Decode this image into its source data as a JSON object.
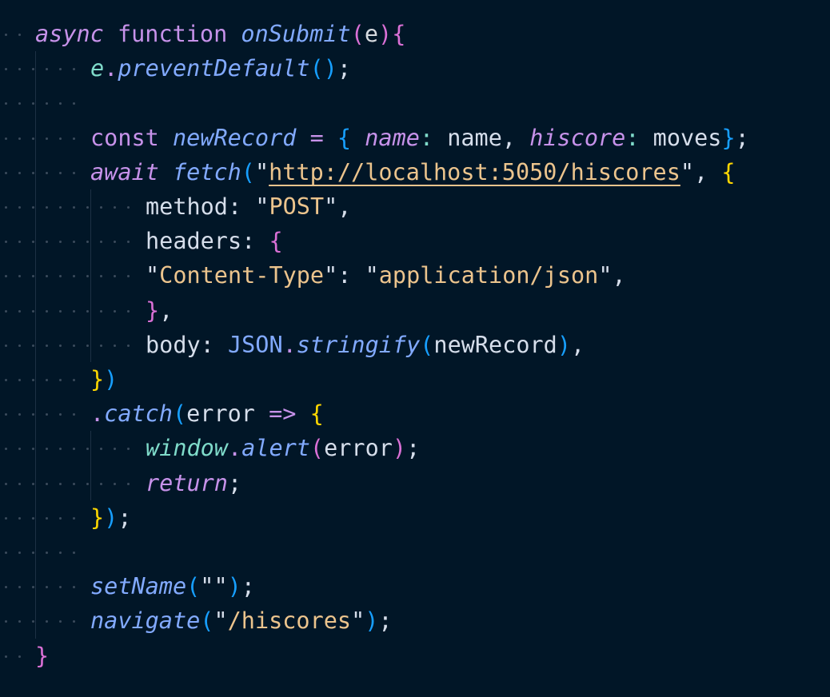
{
  "editor": {
    "theme_colors": {
      "background": "#011627",
      "keyword": "#c792ea",
      "function": "#82aaff",
      "string": "#ecc48d",
      "plain": "#d6deeb",
      "bracket_gold": "#ffd700",
      "bracket_orchid": "#da70d6",
      "bracket_blue": "#179fff"
    },
    "lines": [
      {
        "indent": 0,
        "tokens": [
          {
            "t": "async",
            "c": "kwi"
          },
          {
            "t": " ",
            "c": "pl"
          },
          {
            "t": "function",
            "c": "kw"
          },
          {
            "t": " ",
            "c": "pl"
          },
          {
            "t": "onSubmit",
            "c": "fn"
          },
          {
            "t": "(",
            "c": "b2"
          },
          {
            "t": "e",
            "c": "prm"
          },
          {
            "t": ")",
            "c": "b2"
          },
          {
            "t": "{",
            "c": "b2"
          }
        ]
      },
      {
        "indent": 1,
        "tokens": [
          {
            "t": "e",
            "c": "win"
          },
          {
            "t": ".",
            "c": "dot"
          },
          {
            "t": "preventDefault",
            "c": "fn"
          },
          {
            "t": "()",
            "c": "b3"
          },
          {
            "t": ";",
            "c": "pl"
          }
        ]
      },
      {
        "indent": 1,
        "tokens": []
      },
      {
        "indent": 1,
        "tokens": [
          {
            "t": "const",
            "c": "kw"
          },
          {
            "t": " ",
            "c": "pl"
          },
          {
            "t": "newRecord",
            "c": "var"
          },
          {
            "t": " ",
            "c": "pl"
          },
          {
            "t": "=",
            "c": "kw"
          },
          {
            "t": " ",
            "c": "pl"
          },
          {
            "t": "{",
            "c": "b3"
          },
          {
            "t": " ",
            "c": "pl"
          },
          {
            "t": "name",
            "c": "key"
          },
          {
            "t": ":",
            "c": "pnc"
          },
          {
            "t": " name",
            "c": "pl"
          },
          {
            "t": ",",
            "c": "pl"
          },
          {
            "t": " ",
            "c": "pl"
          },
          {
            "t": "hiscore",
            "c": "key"
          },
          {
            "t": ":",
            "c": "pnc"
          },
          {
            "t": " moves",
            "c": "pl"
          },
          {
            "t": "}",
            "c": "b3"
          },
          {
            "t": ";",
            "c": "pl"
          }
        ]
      },
      {
        "indent": 1,
        "tokens": [
          {
            "t": "await",
            "c": "kwi"
          },
          {
            "t": " ",
            "c": "pl"
          },
          {
            "t": "fetch",
            "c": "fn"
          },
          {
            "t": "(",
            "c": "b3"
          },
          {
            "t": "\"",
            "c": "pl"
          },
          {
            "t": "http://localhost:5050/hiscores",
            "c": "url"
          },
          {
            "t": "\"",
            "c": "pl"
          },
          {
            "t": ",",
            "c": "pl"
          },
          {
            "t": " ",
            "c": "pl"
          },
          {
            "t": "{",
            "c": "b1"
          }
        ]
      },
      {
        "indent": 2,
        "tokens": [
          {
            "t": "method",
            "c": "pl"
          },
          {
            "t": ":",
            "c": "pl"
          },
          {
            "t": " ",
            "c": "pl"
          },
          {
            "t": "\"",
            "c": "pl"
          },
          {
            "t": "POST",
            "c": "str"
          },
          {
            "t": "\"",
            "c": "pl"
          },
          {
            "t": ",",
            "c": "pl"
          }
        ]
      },
      {
        "indent": 2,
        "tokens": [
          {
            "t": "headers",
            "c": "pl"
          },
          {
            "t": ":",
            "c": "pl"
          },
          {
            "t": " ",
            "c": "pl"
          },
          {
            "t": "{",
            "c": "b2"
          }
        ]
      },
      {
        "indent": 2,
        "tokens": [
          {
            "t": "\"",
            "c": "pl"
          },
          {
            "t": "Content-Type",
            "c": "str"
          },
          {
            "t": "\"",
            "c": "pl"
          },
          {
            "t": ":",
            "c": "pl"
          },
          {
            "t": " ",
            "c": "pl"
          },
          {
            "t": "\"",
            "c": "pl"
          },
          {
            "t": "application/json",
            "c": "str"
          },
          {
            "t": "\"",
            "c": "pl"
          },
          {
            "t": ",",
            "c": "pl"
          }
        ]
      },
      {
        "indent": 2,
        "tokens": [
          {
            "t": "}",
            "c": "b2"
          },
          {
            "t": ",",
            "c": "pl"
          }
        ]
      },
      {
        "indent": 2,
        "tokens": [
          {
            "t": "body",
            "c": "pl"
          },
          {
            "t": ":",
            "c": "pl"
          },
          {
            "t": " ",
            "c": "pl"
          },
          {
            "t": "JSON",
            "c": "cls"
          },
          {
            "t": ".",
            "c": "dot"
          },
          {
            "t": "stringify",
            "c": "fn"
          },
          {
            "t": "(",
            "c": "b3"
          },
          {
            "t": "newRecord",
            "c": "pl"
          },
          {
            "t": ")",
            "c": "b3"
          },
          {
            "t": ",",
            "c": "pl"
          }
        ]
      },
      {
        "indent": 1,
        "tokens": [
          {
            "t": "}",
            "c": "b1"
          },
          {
            "t": ")",
            "c": "b3"
          }
        ]
      },
      {
        "indent": 1,
        "tokens": [
          {
            "t": ".",
            "c": "dot"
          },
          {
            "t": "catch",
            "c": "fn"
          },
          {
            "t": "(",
            "c": "b3"
          },
          {
            "t": "error",
            "c": "pl"
          },
          {
            "t": " ",
            "c": "pl"
          },
          {
            "t": "=>",
            "c": "kw"
          },
          {
            "t": " ",
            "c": "pl"
          },
          {
            "t": "{",
            "c": "b1"
          }
        ]
      },
      {
        "indent": 2,
        "tokens": [
          {
            "t": "window",
            "c": "win"
          },
          {
            "t": ".",
            "c": "dot"
          },
          {
            "t": "alert",
            "c": "fn"
          },
          {
            "t": "(",
            "c": "b2"
          },
          {
            "t": "error",
            "c": "pl"
          },
          {
            "t": ")",
            "c": "b2"
          },
          {
            "t": ";",
            "c": "pl"
          }
        ]
      },
      {
        "indent": 2,
        "tokens": [
          {
            "t": "return",
            "c": "kwi"
          },
          {
            "t": ";",
            "c": "pl"
          }
        ]
      },
      {
        "indent": 1,
        "tokens": [
          {
            "t": "}",
            "c": "b1"
          },
          {
            "t": ")",
            "c": "b3"
          },
          {
            "t": ";",
            "c": "pl"
          }
        ]
      },
      {
        "indent": 1,
        "tokens": []
      },
      {
        "indent": 1,
        "tokens": [
          {
            "t": "setName",
            "c": "fn"
          },
          {
            "t": "(",
            "c": "b3"
          },
          {
            "t": "\"\"",
            "c": "pl"
          },
          {
            "t": ")",
            "c": "b3"
          },
          {
            "t": ";",
            "c": "pl"
          }
        ]
      },
      {
        "indent": 1,
        "tokens": [
          {
            "t": "navigate",
            "c": "fn"
          },
          {
            "t": "(",
            "c": "b3"
          },
          {
            "t": "\"",
            "c": "pl"
          },
          {
            "t": "/hiscores",
            "c": "str"
          },
          {
            "t": "\"",
            "c": "pl"
          },
          {
            "t": ")",
            "c": "b3"
          },
          {
            "t": ";",
            "c": "pl"
          }
        ]
      },
      {
        "indent": 0,
        "tokens": [
          {
            "t": "}",
            "c": "b2"
          }
        ]
      }
    ]
  }
}
